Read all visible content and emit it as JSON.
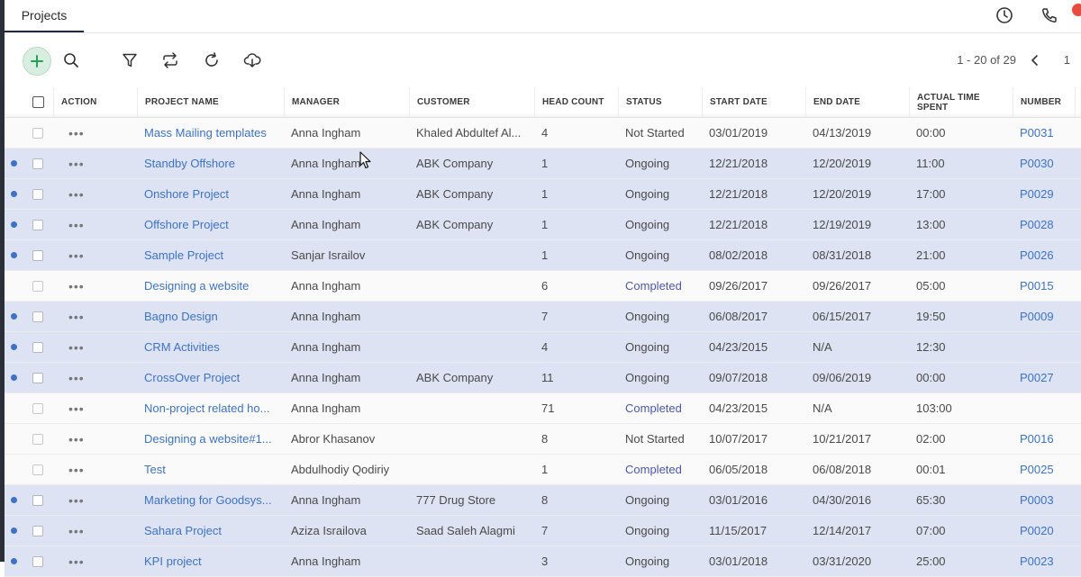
{
  "tabs": [
    {
      "label": "Projects"
    }
  ],
  "toolbar": {
    "pager_text": "1 - 20 of 29",
    "page": "1"
  },
  "colors": {
    "link": "#3d72c8",
    "selected_row": "#dde3f2",
    "completed": "#4c56b0",
    "add_button": "#d8eee0",
    "badge": "#e74c3c"
  },
  "icons": [
    "add-icon",
    "search-icon",
    "filter-icon",
    "sync-icon",
    "refresh-icon",
    "download-icon",
    "clock-icon",
    "phone-icon",
    "chevron-left-icon"
  ],
  "columns": [
    "ACTION",
    "PROJECT NAME",
    "MANAGER",
    "CUSTOMER",
    "HEAD COUNT",
    "STATUS",
    "START DATE",
    "END DATE",
    "ACTUAL TIME SPENT",
    "NUMBER"
  ],
  "rows": [
    {
      "selected": false,
      "name": "Mass Mailing templates",
      "manager": "Anna Ingham",
      "customer": "Khaled Abdultef Al...",
      "headcount": "4",
      "status": "Not Started",
      "start": "03/01/2019",
      "end": "04/13/2019",
      "time": "00:00",
      "number": "P0031"
    },
    {
      "selected": true,
      "name": "Standby Offshore",
      "manager": "Anna Ingham",
      "customer": "ABK Company",
      "headcount": "1",
      "status": "Ongoing",
      "start": "12/21/2018",
      "end": "12/20/2019",
      "time": "11:00",
      "number": "P0030"
    },
    {
      "selected": true,
      "name": "Onshore Project",
      "manager": "Anna Ingham",
      "customer": "ABK Company",
      "headcount": "1",
      "status": "Ongoing",
      "start": "12/21/2018",
      "end": "12/20/2019",
      "time": "17:00",
      "number": "P0029"
    },
    {
      "selected": true,
      "name": "Offshore Project",
      "manager": "Anna Ingham",
      "customer": "ABK Company",
      "headcount": "1",
      "status": "Ongoing",
      "start": "12/21/2018",
      "end": "12/19/2019",
      "time": "13:00",
      "number": "P0028"
    },
    {
      "selected": true,
      "name": "Sample Project",
      "manager": "Sanjar Israilov",
      "customer": "",
      "headcount": "1",
      "status": "Ongoing",
      "start": "08/02/2018",
      "end": "08/31/2018",
      "time": "21:00",
      "number": "P0026"
    },
    {
      "selected": false,
      "name": "Designing a website",
      "manager": "Anna Ingham",
      "customer": "",
      "headcount": "6",
      "status": "Completed",
      "start": "09/26/2017",
      "end": "09/26/2017",
      "time": "05:00",
      "number": "P0015"
    },
    {
      "selected": true,
      "name": "Bagno Design",
      "manager": "Anna Ingham",
      "customer": "",
      "headcount": "7",
      "status": "Ongoing",
      "start": "06/08/2017",
      "end": "06/15/2017",
      "time": "19:50",
      "number": "P0009"
    },
    {
      "selected": true,
      "name": "CRM Activities",
      "manager": "Anna Ingham",
      "customer": "",
      "headcount": "4",
      "status": "Ongoing",
      "start": "04/23/2015",
      "end": "N/A",
      "time": "12:30",
      "number": ""
    },
    {
      "selected": true,
      "name": "CrossOver Project",
      "manager": "Anna Ingham",
      "customer": "ABK Company",
      "headcount": "11",
      "status": "Ongoing",
      "start": "09/07/2018",
      "end": "09/06/2019",
      "time": "00:00",
      "number": "P0027"
    },
    {
      "selected": false,
      "name": "Non-project related ho...",
      "manager": "Anna Ingham",
      "customer": "",
      "headcount": "71",
      "status": "Completed",
      "start": "04/23/2015",
      "end": "N/A",
      "time": "103:00",
      "number": ""
    },
    {
      "selected": false,
      "name": "Designing a website#1...",
      "manager": "Abror Khasanov",
      "customer": "",
      "headcount": "8",
      "status": "Not Started",
      "start": "10/07/2017",
      "end": "10/21/2017",
      "time": "02:00",
      "number": "P0016"
    },
    {
      "selected": false,
      "name": "Test",
      "manager": "Abdulhodiy Qodiriy",
      "customer": "",
      "headcount": "1",
      "status": "Completed",
      "start": "06/05/2018",
      "end": "06/08/2018",
      "time": "00:01",
      "number": "P0025"
    },
    {
      "selected": true,
      "name": "Marketing for Goodsys...",
      "manager": "Anna Ingham",
      "customer": "777 Drug Store",
      "headcount": "8",
      "status": "Ongoing",
      "start": "03/01/2016",
      "end": "04/30/2016",
      "time": "65:30",
      "number": "P0003"
    },
    {
      "selected": true,
      "name": "Sahara Project",
      "manager": "Aziza Israilova",
      "customer": "Saad Saleh Alagmi",
      "headcount": "7",
      "status": "Ongoing",
      "start": "11/15/2017",
      "end": "12/14/2017",
      "time": "07:00",
      "number": "P0020"
    },
    {
      "selected": true,
      "name": "KPI project",
      "manager": "Anna Ingham",
      "customer": "",
      "headcount": "3",
      "status": "Ongoing",
      "start": "03/01/2018",
      "end": "03/31/2020",
      "time": "25:00",
      "number": "P0023"
    }
  ]
}
